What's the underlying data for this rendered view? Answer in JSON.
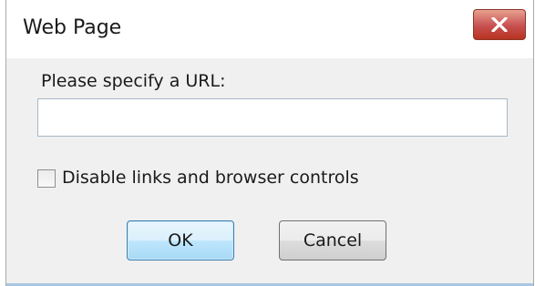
{
  "dialog": {
    "title": "Web Page",
    "close_icon": "close-x-icon",
    "close_color": "#c75050"
  },
  "form": {
    "url_label": "Please specify a URL:",
    "url_value": "",
    "url_placeholder": "",
    "disable_links_label": "Disable links and browser controls",
    "disable_links_checked": false
  },
  "buttons": {
    "ok_label": "OK",
    "cancel_label": "Cancel"
  }
}
